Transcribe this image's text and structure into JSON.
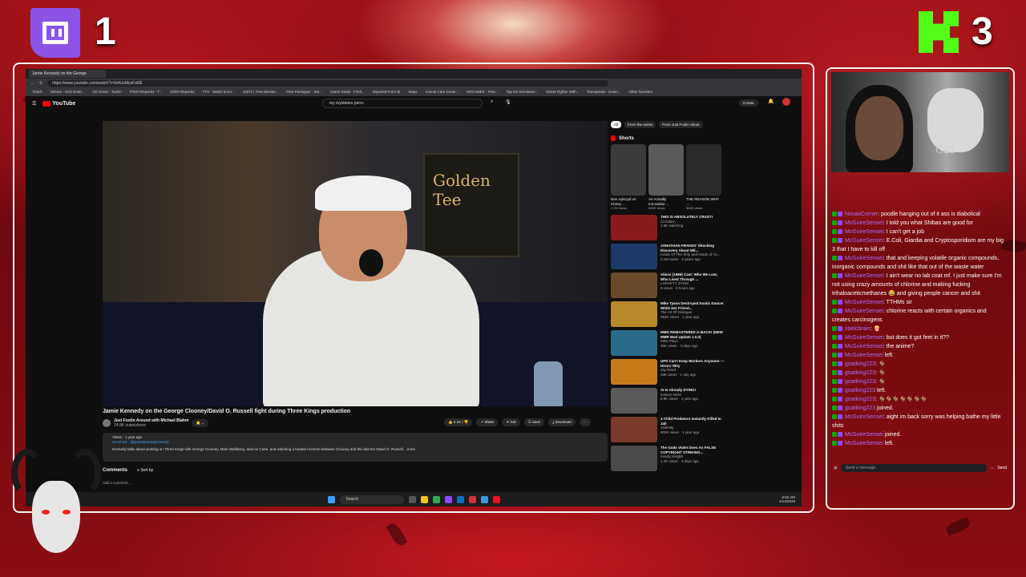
{
  "overlay": {
    "twitch_count": "1",
    "kick_count": "3"
  },
  "browser": {
    "tab_title": "Jamie Kennedy on the George",
    "url": "https://www.youtube.com/watch?v=bAUoMyxFaRE",
    "bookmarks": [
      "Twitch",
      "Stream - Kick Dash...",
      "CD Home - Twitch",
      "FitGirl Repacks - T...",
      "DODI Repacks",
      "YTS - Watch & Do...",
      "1337x | Free Movies...",
      "Free Packages - Ste...",
      "Game Deals - Findi...",
      "Imported From IE",
      "Maps",
      "Animal Care Cente...",
      "KKGAMES - Free...",
      "Top NS Emulation...",
      "Street Fighter 30th...",
      "Romspedia - Down...",
      "Other favorites"
    ]
  },
  "youtube": {
    "logo": "YouTube",
    "search_value": "my mysteries perro",
    "create_label": "Create",
    "video_title": "Jamie Kennedy on the George Clooney/David O. Russell fight during Three Kings production",
    "channel_name": "Just Foolin Around with Michael Blahm",
    "subscribers": "24.8K subscribers",
    "likes": "4.1K",
    "share": "Share",
    "ask": "Ask",
    "save": "Save",
    "download": "Download",
    "views_age": "Views · 1 year ago",
    "episode": "on S2 E3 · @jamiekennedycomedy",
    "description": "Kennedy talks about working on Three Kings with George Clooney, Mark Wahlberg, and Ice Cube, and watching a heated moment between Clooney and the director David O. Russell  ...more",
    "comments_label": "Comments",
    "sort_label": "Sort by",
    "add_comment": "Add a comment...",
    "chips": [
      "All",
      "From the series",
      "From Just Foolin About"
    ],
    "shorts_label": "Shorts",
    "shorts": [
      {
        "title": "Dan Aykroyd on Chevy ...",
        "views": "2.7M views",
        "color": "#3b3b3b"
      },
      {
        "title": "An Actually Innovative ...",
        "views": "555K views",
        "color": "#5a5a5a"
      },
      {
        "title": "THE REASON WHY ...",
        "views": "364K views",
        "color": "#2a2a2a"
      }
    ],
    "videos": [
      {
        "title": "THIS IS ABSOLUTELY CRAZY!",
        "channel": "ZJ Daley",
        "stats": "1.9K watching",
        "color": "#8a1a1a"
      },
      {
        "title": "JONATHAN FRAKES' Shocking Discovery About Wil...",
        "channel": "Inside Of The Ship and Inside of Yo...",
        "stats": "3.1M views · 2 years ago",
        "color": "#1d3a6a"
      },
      {
        "title": "Aliens (1986) Cast: Who We Lost, Who Lived Through ...",
        "channel": "LOKKETY ZYGM",
        "stats": "9 views · 8 hours ago",
        "color": "#6b4a2a"
      },
      {
        "title": "Mike Tyson Destroyed Exotic Dancer While Her Friend...",
        "channel": "The Art Of Dialogue",
        "stats": "362K views · 1 year ago",
        "color": "#b8892a"
      },
      {
        "title": "MMG REMASTERED is BACK! (NEW MMR Mod Update 1.0.0)",
        "channel": "Mike Plays",
        "stats": "30K views · 3 days ago",
        "color": "#2a6a8a"
      },
      {
        "title": "UPS Can't Keep Workers Anymore — Here's Why",
        "channel": "Jay Reed",
        "stats": "33K views · 1 day ago",
        "color": "#c87a1a"
      },
      {
        "title": "AI Is Already DYING!",
        "channel": "Gaston Mehl",
        "stats": "8.9K views · 1 year ago",
        "color": "#5a5a5a"
      },
      {
        "title": "4 Child Predators Instantly Killed In Jail",
        "channel": "Jailmaty",
        "stats": "900K views · 1 year ago",
        "color": "#7a3a2a"
      },
      {
        "title": "The Gods Violet Does An FALSE COPYRIGHT STRIKING...",
        "channel": "Kandy King86",
        "stats": "1.4K views · 3 days ago",
        "color": "#4a4a4a"
      }
    ]
  },
  "taskbar": {
    "search": "Search",
    "time": "6:52 AM",
    "date": "4/14/2025"
  },
  "webcam": {
    "tag": "G23"
  },
  "chat": {
    "messages": [
      {
        "user": "NovasCorner",
        "text": ": poodle hanging out of it ass is diabolical"
      },
      {
        "user": "McGuireSensei",
        "text": ": I told you what Shibas are good for"
      },
      {
        "user": "McGuireSensei",
        "text": ": I can't get a job"
      },
      {
        "user": "McGuireSensei",
        "text": ": E.Coli, Giardia and Cryptosporidium are my big 3 that I have to kill off"
      },
      {
        "user": "McGuireSensei",
        "text": ": that and keeping volatile organic compounds, inorganic compounds and shit like that out of the waste water"
      },
      {
        "user": "McGuireSensei",
        "text": ": I ain't wear no lab coat mf. I just make sure I'm not using crazy amounts of chlorine and making fucking trihaloaceticmethanes 😂 and giving people cancer and shit"
      },
      {
        "user": "McGuireSensei",
        "text": ": TTHMs sir"
      },
      {
        "user": "McGuireSensei",
        "text": ": chlorine reacts with certain organics and creates carcinogens"
      },
      {
        "user": "staticbrain",
        "text": ": 🍿"
      },
      {
        "user": "McGuireSensei",
        "text": ": but does it got feet in it??"
      },
      {
        "user": "McGuireSensei",
        "text": ": the anime?"
      },
      {
        "user": "McGuireSensei",
        "text": " left."
      },
      {
        "user": "goatking223",
        "text": ": 🐐"
      },
      {
        "user": "goatking223",
        "text": ": 🐐"
      },
      {
        "user": "goatking223",
        "text": ": 🐐"
      },
      {
        "user": "goatking223",
        "text": " left."
      },
      {
        "user": "goatking223",
        "text": ": 🐐🐐🐐🐐🐐🐐🐐"
      },
      {
        "user": "goatking223",
        "text": " joined."
      },
      {
        "user": "McGuireSensei",
        "text": ": aight im back sorry was helping bathe my little shits"
      },
      {
        "user": "McGuireSensei",
        "text": " joined."
      },
      {
        "user": "McGuireSensei",
        "text": " left."
      }
    ],
    "input_placeholder": "Send a message",
    "send_label": "Send"
  }
}
